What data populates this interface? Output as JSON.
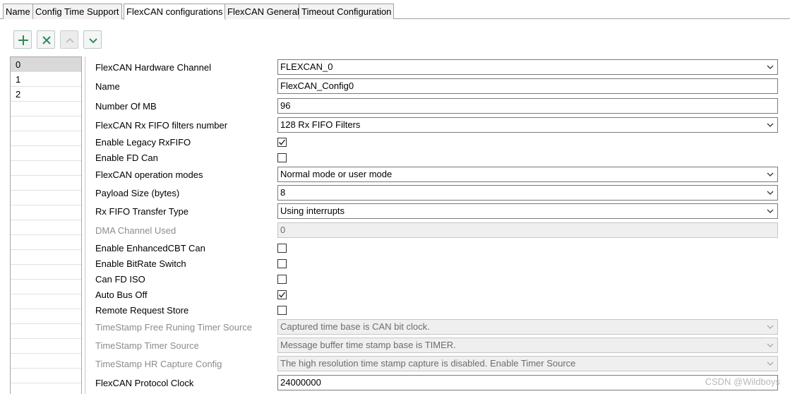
{
  "tabs": [
    {
      "label": "Name"
    },
    {
      "label": "Config Time Support"
    },
    {
      "label": "FlexCAN configurations",
      "active": true
    },
    {
      "label": "FlexCAN General"
    },
    {
      "label": "Timeout Configuration"
    }
  ],
  "toolbar": {
    "add": "plus-icon",
    "remove": "x-icon",
    "up": "chevron-up-icon",
    "down": "chevron-down-icon",
    "accent": "#2e8b57"
  },
  "list": {
    "items": [
      "0",
      "1",
      "2"
    ],
    "selected": "0"
  },
  "properties": {
    "hardware_channel": {
      "label": "FlexCAN Hardware Channel",
      "value": "FLEXCAN_0"
    },
    "name": {
      "label": "Name",
      "value": "FlexCAN_Config0"
    },
    "number_of_mb": {
      "label": "Number Of MB",
      "value": "96"
    },
    "rx_fifo_filters": {
      "label": "FlexCAN Rx FIFO filters number",
      "value": "128 Rx FIFO Filters"
    },
    "legacy_rxfifo": {
      "label": "Enable Legacy RxFIFO",
      "checked": true
    },
    "enable_fd": {
      "label": "Enable FD Can",
      "checked": false
    },
    "operation_modes": {
      "label": "FlexCAN operation modes",
      "value": "Normal mode or user mode"
    },
    "payload_size": {
      "label": "Payload Size (bytes)",
      "value": "8"
    },
    "rx_fifo_transfer": {
      "label": "Rx FIFO Transfer Type",
      "value": "Using interrupts"
    },
    "dma_channel": {
      "label": "DMA Channel Used",
      "value": "0"
    },
    "enhanced_cbt": {
      "label": "Enable EnhancedCBT Can",
      "checked": false
    },
    "bitrate_switch": {
      "label": "Enable BitRate Switch",
      "checked": false
    },
    "fd_iso": {
      "label": "Can FD ISO",
      "checked": false
    },
    "auto_bus_off": {
      "label": "Auto Bus Off",
      "checked": true
    },
    "remote_request": {
      "label": "Remote Request Store",
      "checked": false
    },
    "ts_free_running": {
      "label": "TimeStamp Free Runing Timer Source",
      "value": "Captured time base is CAN bit clock."
    },
    "ts_timer_source": {
      "label": "TimeStamp Timer Source",
      "value": "Message buffer time stamp base is TIMER."
    },
    "ts_hr_capture": {
      "label": "TimeStamp HR Capture Config",
      "value": "The high resolution time stamp capture is disabled. Enable Timer Source"
    },
    "protocol_clock": {
      "label": "FlexCAN Protocol Clock",
      "value": "24000000"
    }
  },
  "watermark": "CSDN @Wildboys"
}
